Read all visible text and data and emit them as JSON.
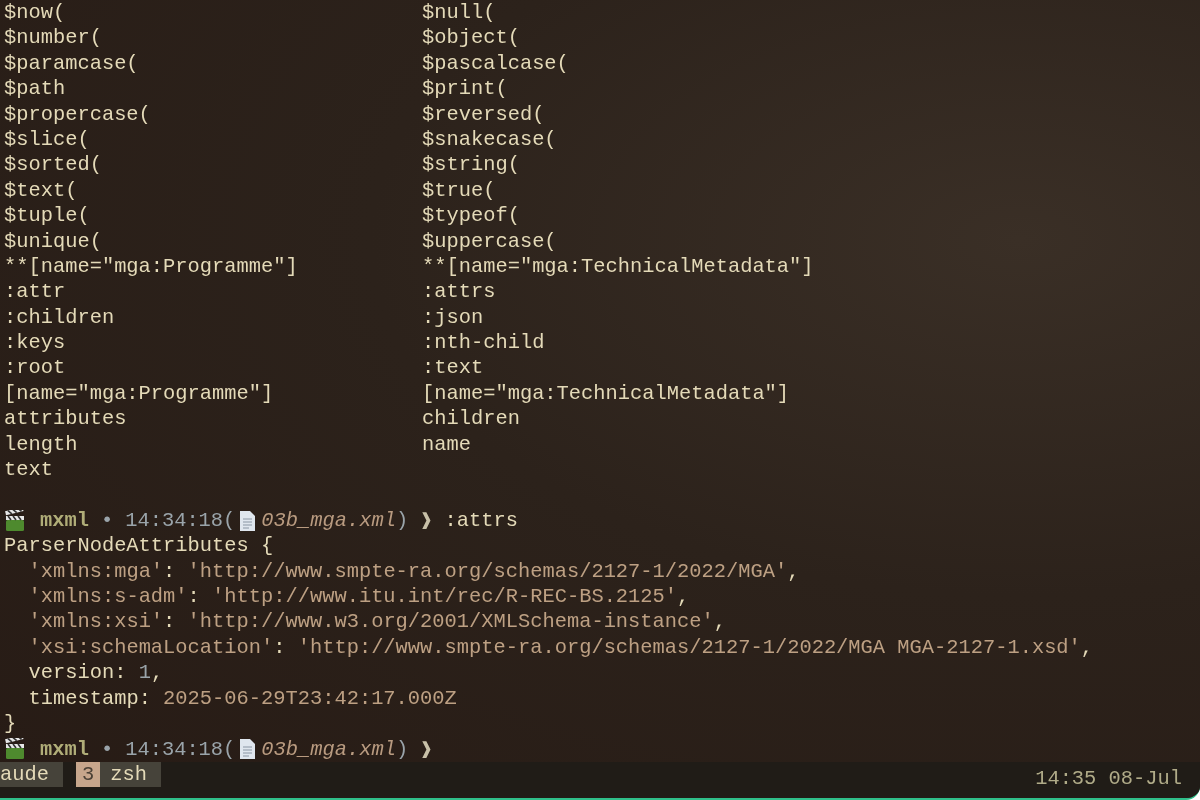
{
  "completions": {
    "column_1": [
      "$now(",
      "$number(",
      "$paramcase(",
      "$path",
      "$propercase(",
      "$slice(",
      "$sorted(",
      "$text(",
      "$tuple(",
      "$unique(",
      "**[name=\"mga:Programme\"]",
      ":attr",
      ":children",
      ":keys",
      ":root",
      "[name=\"mga:Programme\"]",
      "attributes",
      "length",
      "text"
    ],
    "column_2": [
      "$null(",
      "$object(",
      "$pascalcase(",
      "$print(",
      "$reversed(",
      "$snakecase(",
      "$string(",
      "$true(",
      "$typeof(",
      "$uppercase(",
      "**[name=\"mga:TechnicalMetadata\"]",
      ":attrs",
      ":json",
      ":nth-child",
      ":text",
      "[name=\"mga:TechnicalMetadata\"]",
      "children",
      "name"
    ]
  },
  "prompt_1": {
    "app": "mxml",
    "separator": "•",
    "time": "14:34:18",
    "open_paren": "(",
    "file": "03b_mga.xml",
    "close_paren": ")",
    "caret": "❱",
    "command": ":attrs"
  },
  "output": {
    "open": "ParserNodeAttributes {",
    "entries": [
      [
        {
          "kind": "string",
          "text": "'xmlns:mga'"
        },
        {
          "kind": "plain",
          "text": ": "
        },
        {
          "kind": "string",
          "text": "'http://www.smpte-ra.org/schemas/2127-1/2022/MGA'"
        },
        {
          "kind": "plain",
          "text": ","
        }
      ],
      [
        {
          "kind": "string",
          "text": "'xmlns:s-adm'"
        },
        {
          "kind": "plain",
          "text": ": "
        },
        {
          "kind": "string",
          "text": "'http://www.itu.int/rec/R-REC-BS.2125'"
        },
        {
          "kind": "plain",
          "text": ","
        }
      ],
      [
        {
          "kind": "string",
          "text": "'xmlns:xsi'"
        },
        {
          "kind": "plain",
          "text": ": "
        },
        {
          "kind": "string",
          "text": "'http://www.w3.org/2001/XMLSchema-instance'"
        },
        {
          "kind": "plain",
          "text": ","
        }
      ],
      [
        {
          "kind": "string",
          "text": "'xsi:schemaLocation'"
        },
        {
          "kind": "plain",
          "text": ": "
        },
        {
          "kind": "string",
          "text": "'http://www.smpte-ra.org/schemas/2127-1/2022/MGA MGA-2127-1.xsd'"
        },
        {
          "kind": "plain",
          "text": ","
        }
      ],
      [
        {
          "kind": "plain",
          "text": "version: "
        },
        {
          "kind": "number",
          "text": "1"
        },
        {
          "kind": "plain",
          "text": ","
        }
      ],
      [
        {
          "kind": "plain",
          "text": "timestamp: "
        },
        {
          "kind": "date",
          "text": "2025-06-29T23:42:17.000Z"
        }
      ]
    ],
    "close": "}"
  },
  "prompt_2": {
    "app": "mxml",
    "separator": "•",
    "time": "14:34:18",
    "open_paren": "(",
    "file": "03b_mga.xml",
    "close_paren": ")",
    "caret": "❱"
  },
  "status_bar": {
    "windows": [
      {
        "label": "aude"
      },
      {
        "index": "3",
        "label": "zsh"
      }
    ],
    "clock": "14:35 08-Jul"
  }
}
